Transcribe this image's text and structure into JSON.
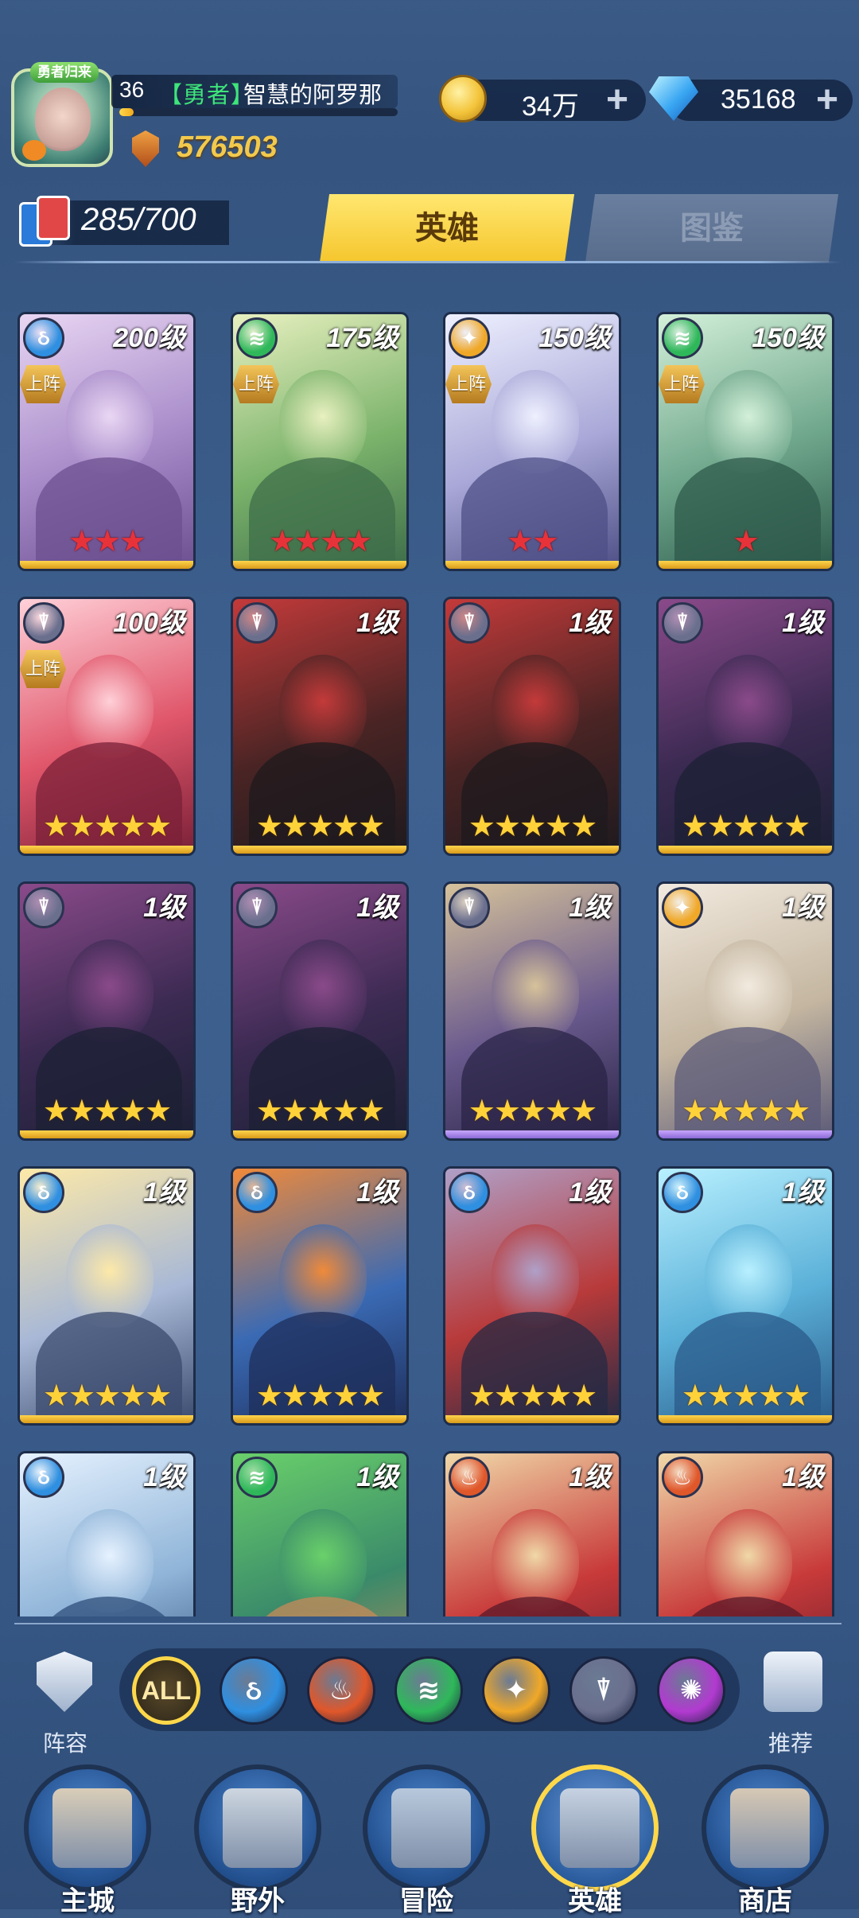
{
  "player": {
    "level": "36",
    "title": "【勇者】",
    "name": "智慧的阿罗那",
    "avatar_badge": "勇者归来",
    "exp_fraction": 0.05,
    "power": "576503"
  },
  "resources": {
    "gold": "34万",
    "diamonds": "35168"
  },
  "collection": {
    "count": "285/700"
  },
  "tabs": {
    "heroes": "英雄",
    "codex": "图鉴"
  },
  "heroes": [
    {
      "level": "200级",
      "faction": "water",
      "deployed": true,
      "deploy_label": "上阵",
      "stars": "★★★",
      "star_color": "red",
      "palette": [
        "#e9d6f3",
        "#a78bc9",
        "#6b4f8f"
      ]
    },
    {
      "level": "175级",
      "faction": "wind",
      "deployed": true,
      "deploy_label": "上阵",
      "stars": "★★★★",
      "star_color": "red",
      "palette": [
        "#e8f0c0",
        "#7bb36b",
        "#3e6d4a"
      ]
    },
    {
      "level": "150级",
      "faction": "light",
      "deployed": true,
      "deploy_label": "上阵",
      "stars": "★★",
      "star_color": "red",
      "palette": [
        "#eef0ff",
        "#a9a8d8",
        "#4e4f86"
      ]
    },
    {
      "level": "150级",
      "faction": "wind",
      "deployed": true,
      "deploy_label": "上阵",
      "stars": "★",
      "star_color": "red",
      "palette": [
        "#d3f0d9",
        "#6fa78c",
        "#2d5a4b"
      ]
    },
    {
      "level": "100级",
      "faction": "dark",
      "deployed": true,
      "deploy_label": "上阵",
      "stars": "★★★★★",
      "star_color": "gold",
      "palette": [
        "#ffd0d8",
        "#e0566a",
        "#7a2038"
      ]
    },
    {
      "level": "1级",
      "faction": "dark",
      "deployed": false,
      "stars": "★★★★★",
      "star_color": "gold",
      "palette": [
        "#c43a3a",
        "#4a2424",
        "#1e1a1e"
      ]
    },
    {
      "level": "1级",
      "faction": "dark",
      "deployed": false,
      "stars": "★★★★★",
      "star_color": "gold",
      "palette": [
        "#c43a3a",
        "#4a2424",
        "#1e1a1e"
      ]
    },
    {
      "level": "1级",
      "faction": "dark",
      "deployed": false,
      "stars": "★★★★★",
      "star_color": "gold",
      "palette": [
        "#8a4a8a",
        "#3b2a52",
        "#1c2034"
      ]
    },
    {
      "level": "1级",
      "faction": "dark",
      "deployed": false,
      "stars": "★★★★★",
      "star_color": "gold",
      "palette": [
        "#8a4a8a",
        "#3b2a52",
        "#1c2034"
      ]
    },
    {
      "level": "1级",
      "faction": "dark",
      "deployed": false,
      "stars": "★★★★★",
      "star_color": "gold",
      "palette": [
        "#8a4a8a",
        "#3b2a52",
        "#1c2034"
      ]
    },
    {
      "level": "1级",
      "faction": "dark",
      "deployed": false,
      "stars": "★★★★★",
      "star_color": "gold",
      "base": "purple",
      "palette": [
        "#d6c29a",
        "#6a5a8e",
        "#2a2446"
      ]
    },
    {
      "level": "1级",
      "faction": "light",
      "deployed": false,
      "stars": "★★★★★",
      "star_color": "gold",
      "base": "purple",
      "palette": [
        "#f2eadf",
        "#c4b6a0",
        "#5b5a78"
      ]
    },
    {
      "level": "1级",
      "faction": "water",
      "deployed": false,
      "stars": "★★★★★",
      "star_color": "gold",
      "palette": [
        "#fde9a8",
        "#a8b8d6",
        "#3a4a6e"
      ]
    },
    {
      "level": "1级",
      "faction": "water",
      "deployed": false,
      "stars": "★★★★★",
      "star_color": "gold",
      "palette": [
        "#f08a3a",
        "#3a6ab4",
        "#1e2e5a"
      ]
    },
    {
      "level": "1级",
      "faction": "water",
      "deployed": false,
      "stars": "★★★★★",
      "star_color": "gold",
      "palette": [
        "#b0a0c8",
        "#b83a3a",
        "#242a44"
      ]
    },
    {
      "level": "1级",
      "faction": "water",
      "deployed": false,
      "stars": "★★★★★",
      "star_color": "gold",
      "palette": [
        "#b8f0ff",
        "#5ab0d8",
        "#2a5a8a"
      ]
    },
    {
      "level": "1级",
      "faction": "water",
      "deployed": false,
      "stars": "",
      "star_color": "gold",
      "palette": [
        "#e6f2ff",
        "#8fb4d8",
        "#2e4e7a"
      ]
    },
    {
      "level": "1级",
      "faction": "wind",
      "deployed": false,
      "stars": "",
      "star_color": "gold",
      "palette": [
        "#6ad06a",
        "#3a8a6a",
        "#c88a5a"
      ]
    },
    {
      "level": "1级",
      "faction": "fire",
      "deployed": false,
      "stars": "",
      "star_color": "gold",
      "palette": [
        "#f0d8a8",
        "#c83a3a",
        "#5a1a2a"
      ]
    },
    {
      "level": "1级",
      "faction": "fire",
      "deployed": false,
      "stars": "",
      "star_color": "gold",
      "palette": [
        "#f0d8a8",
        "#c83a3a",
        "#5a1a2a"
      ]
    }
  ],
  "filters": {
    "lineup_label": "阵容",
    "recommend_label": "推荐",
    "all_label": "ALL",
    "factions": [
      "water",
      "fire",
      "wind",
      "light",
      "dark",
      "chaos"
    ]
  },
  "faction_colors": {
    "water": "#2f8fe0",
    "fire": "#e0572a",
    "wind": "#2fb85a",
    "light": "#f0a828",
    "dark": "#6a6f8e",
    "chaos": "#b23ad0"
  },
  "faction_glyphs": {
    "water": "ઠ",
    "fire": "♨",
    "wind": "≋",
    "light": "✦",
    "dark": "⍒",
    "chaos": "✺"
  },
  "nav": [
    {
      "label": "主城",
      "icon": "castle-icon",
      "active": false
    },
    {
      "label": "野外",
      "icon": "portal-icon",
      "active": false
    },
    {
      "label": "冒险",
      "icon": "sword-icon",
      "active": false
    },
    {
      "label": "英雄",
      "icon": "knight-helmet-icon",
      "active": true
    },
    {
      "label": "商店",
      "icon": "shop-icon",
      "active": false
    }
  ]
}
